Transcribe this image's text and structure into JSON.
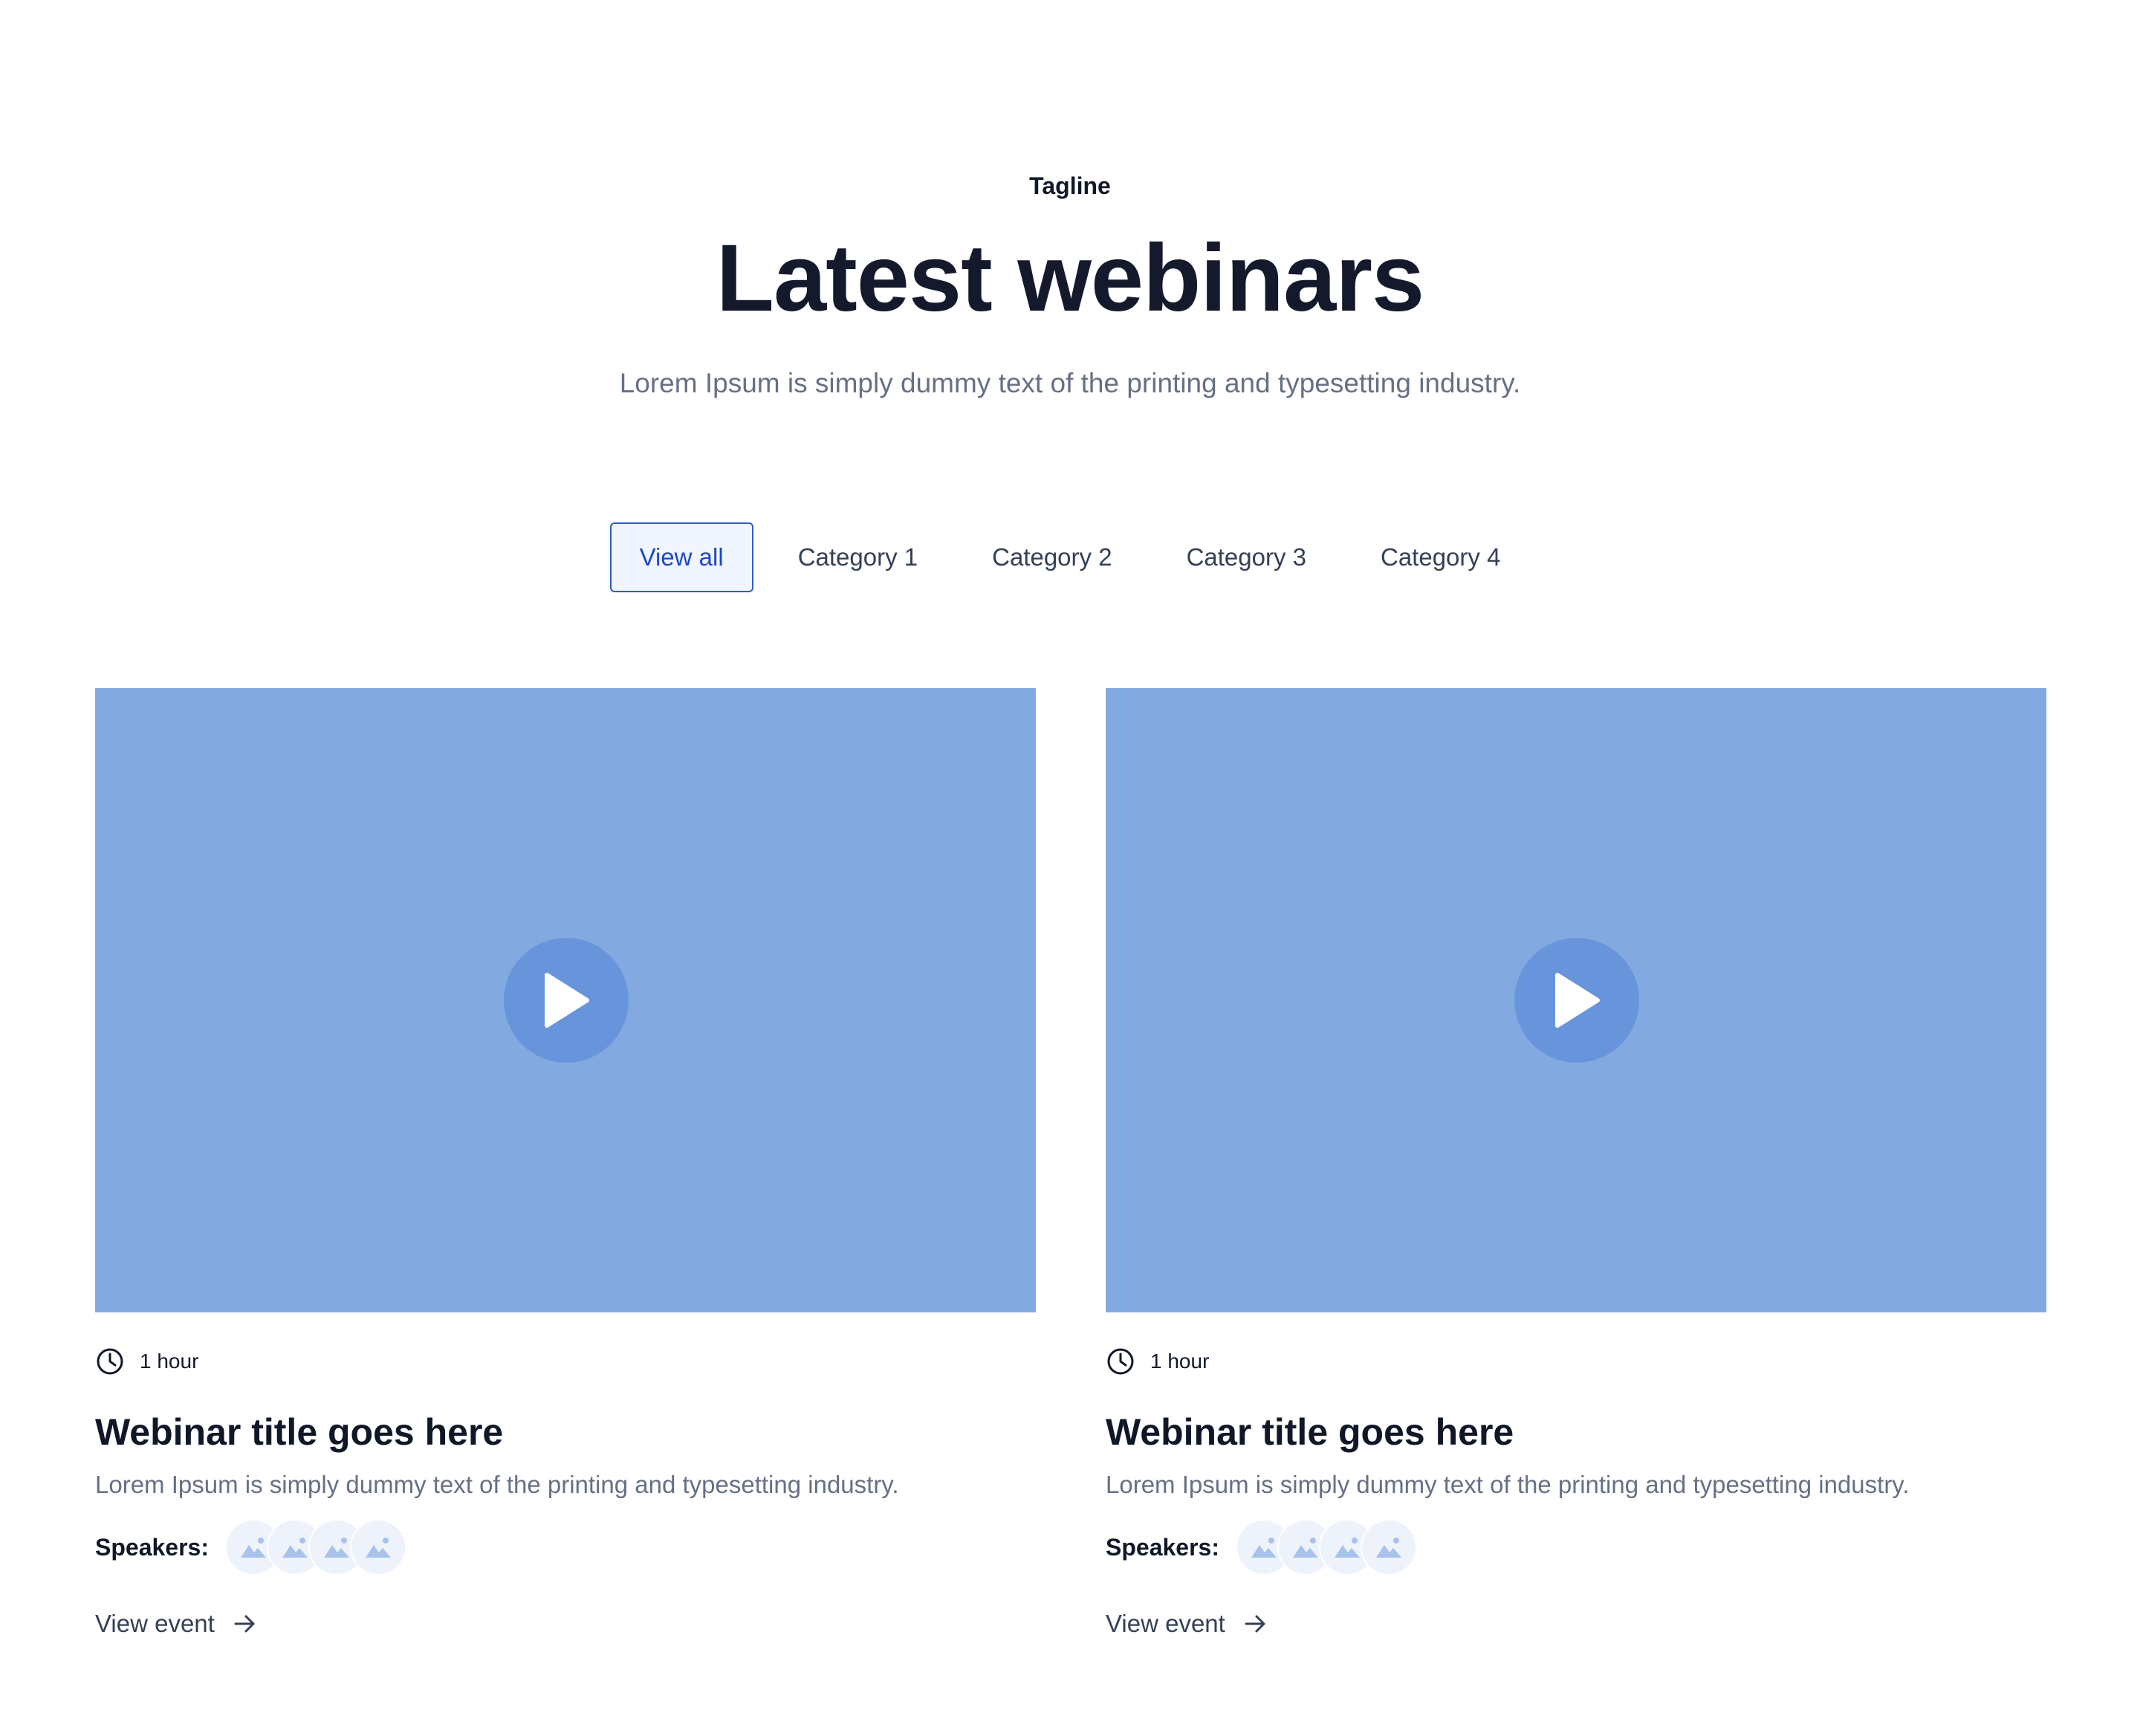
{
  "header": {
    "tagline": "Tagline",
    "title": "Latest webinars",
    "subtitle": "Lorem Ipsum is simply dummy text of the printing and typesetting industry."
  },
  "tabs": [
    {
      "label": "View all",
      "active": true
    },
    {
      "label": "Category 1",
      "active": false
    },
    {
      "label": "Category 2",
      "active": false
    },
    {
      "label": "Category 3",
      "active": false
    },
    {
      "label": "Category 4",
      "active": false
    }
  ],
  "cards": [
    {
      "duration": "1 hour",
      "title": "Webinar title goes here",
      "description": "Lorem Ipsum is simply dummy text of the printing and typesetting industry.",
      "speakers_label": "Speakers:",
      "link_label": "View event"
    },
    {
      "duration": "1 hour",
      "title": "Webinar title goes here",
      "description": "Lorem Ipsum is simply dummy text of the printing and typesetting industry.",
      "speakers_label": "Speakers:",
      "link_label": "View event"
    }
  ],
  "icons": {
    "play": "play-icon",
    "clock": "clock-icon",
    "avatar": "image-placeholder-icon",
    "arrow": "arrow-right-icon"
  },
  "colors": {
    "accent": "#1d48c4",
    "tab_active_bg": "#f0f5ff",
    "media_bg": "#83a9e1",
    "play_bg": "#6894dc",
    "text_muted": "#667085"
  }
}
